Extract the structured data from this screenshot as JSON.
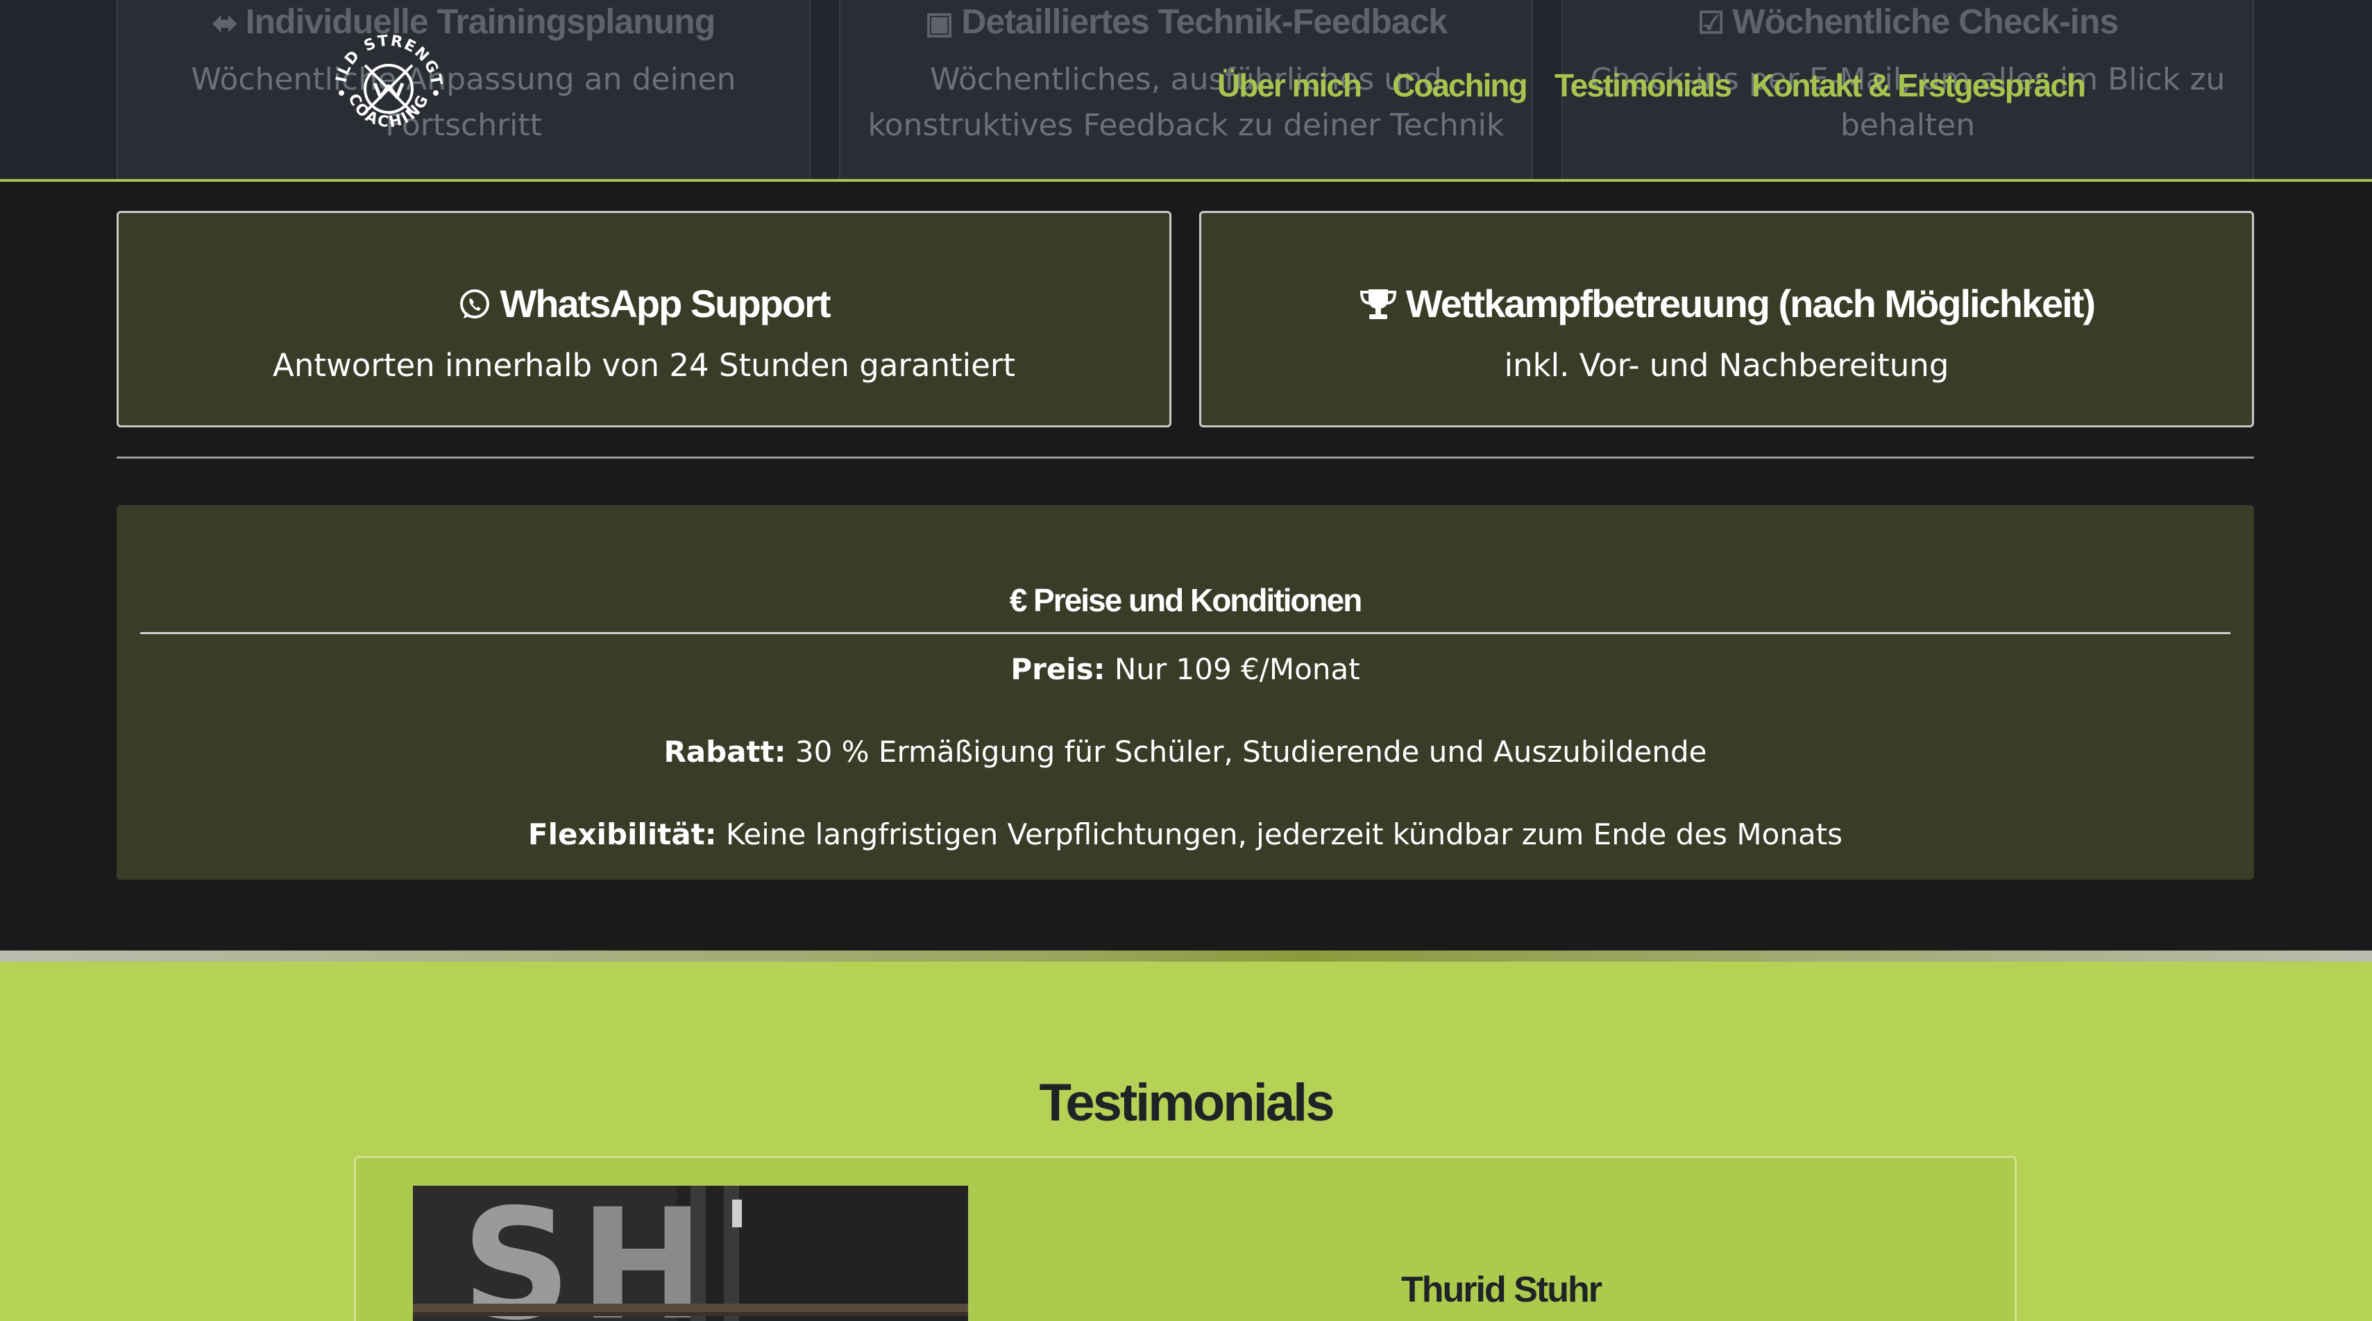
{
  "header": {
    "logo_text_top": "WILD STRENGTH",
    "logo_text_bottom": "COACHING",
    "nav": [
      {
        "label": "Über mich"
      },
      {
        "label": "Coaching"
      },
      {
        "label": "Testimonials"
      },
      {
        "label": "Kontakt & Erstgespräch"
      }
    ],
    "background_cards": [
      {
        "icon": "dumbbell-icon",
        "title": "Individuelle Trainingsplanung",
        "text": "Wöchentliche Anpassung an deinen Fortschritt"
      },
      {
        "icon": "presentation-icon",
        "title": "Detailliertes Technik-Feedback",
        "text": "Wöchentliches, ausführliches und konstruktives Feedback zu deiner Technik"
      },
      {
        "icon": "calendar-check-icon",
        "title": "Wöchentliche Check-ins",
        "text": "Check-ins per E-Mail, um alles im Blick zu behalten"
      }
    ]
  },
  "features": [
    {
      "icon": "whatsapp-icon",
      "title": "WhatsApp Support",
      "text": "Antworten innerhalb von 24 Stunden garantiert"
    },
    {
      "icon": "trophy-icon",
      "title": "Wettkampfbetreuung (nach Möglichkeit)",
      "text": "inkl. Vor- und Nachbereitung"
    }
  ],
  "pricing": {
    "title": "€ Preise und Konditionen",
    "lines": [
      {
        "label": "Preis:",
        "text": "Nur 109 €/Monat"
      },
      {
        "label": "Rabatt:",
        "text": "30 % Ermäßigung für Schüler, Studierende und Auszubildende"
      },
      {
        "label": "Flexibilität:",
        "text": "Keine langfristigen Verpflichtungen, jederzeit kündbar zum Ende des Monats"
      }
    ]
  },
  "testimonials": {
    "heading": "Testimonials",
    "items": [
      {
        "name": "Thurid Stuhr"
      }
    ]
  },
  "colors": {
    "accent": "#a7c44f",
    "dark_bg": "#1a1a1a",
    "card_bg": "#3a3c28",
    "testimonial_bg": "#b5d156"
  }
}
